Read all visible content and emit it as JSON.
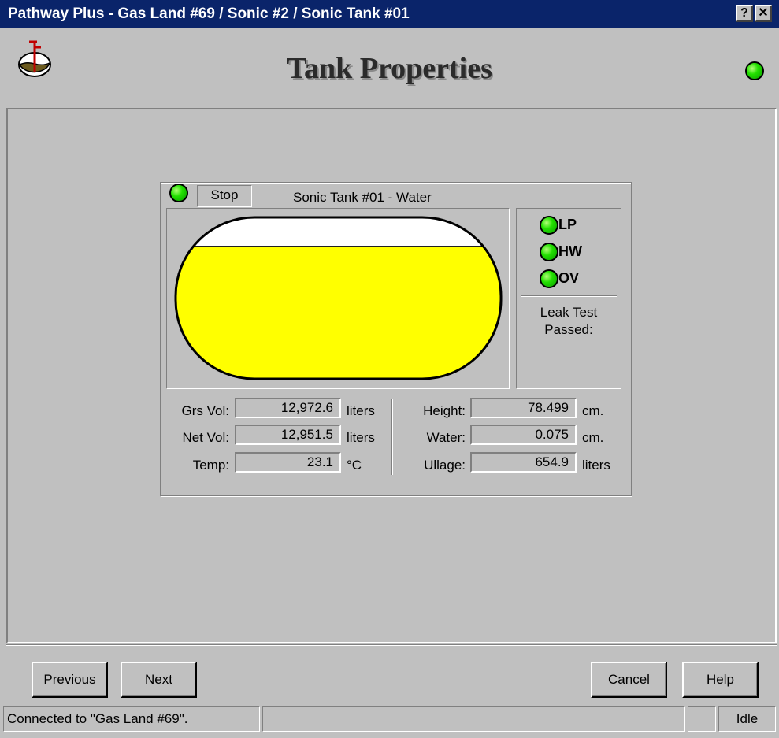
{
  "window": {
    "title": "Pathway Plus - Gas Land #69 / Sonic #2 / Sonic Tank #01",
    "help_glyph": "?",
    "close_glyph": "✕"
  },
  "header": {
    "title": "Tank Properties",
    "icon": "tank-icon",
    "status_led_color": "#22e000"
  },
  "tank": {
    "status_led_color": "#22e000",
    "stop_label": "Stop",
    "name": "Sonic Tank #01 - Water",
    "fill_color": "#ffff00",
    "fill_level_pct": 82,
    "indicators": [
      {
        "label": "LP",
        "color": "#22e000"
      },
      {
        "label": "HW",
        "color": "#22e000"
      },
      {
        "label": "OV",
        "color": "#22e000"
      }
    ],
    "leak_test_line1": "Leak Test",
    "leak_test_line2": "Passed:"
  },
  "readings": {
    "grs_vol": {
      "label": "Grs Vol:",
      "value": "12,972.6",
      "unit": "liters"
    },
    "net_vol": {
      "label": "Net Vol:",
      "value": "12,951.5",
      "unit": "liters"
    },
    "temp": {
      "label": "Temp:",
      "value": "23.1",
      "unit": "°C"
    },
    "height": {
      "label": "Height:",
      "value": "78.499",
      "unit": "cm."
    },
    "water": {
      "label": "Water:",
      "value": "0.075",
      "unit": "cm."
    },
    "ullage": {
      "label": "Ullage:",
      "value": "654.9",
      "unit": "liters"
    }
  },
  "buttons": {
    "previous": "Previous",
    "next": "Next",
    "cancel": "Cancel",
    "help": "Help"
  },
  "statusbar": {
    "connection": "Connected to \"Gas Land #69\".",
    "middle": "",
    "small": "",
    "state": "Idle"
  }
}
